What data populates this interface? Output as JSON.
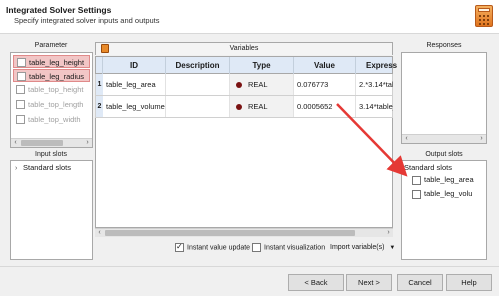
{
  "dialog": {
    "title": "Integrated Solver Settings",
    "subtitle": "Specify integrated solver inputs and outputs"
  },
  "parameter_panel": {
    "title": "Parameter",
    "items": [
      {
        "label": "table_leg_height",
        "selected": true,
        "dimmed": false
      },
      {
        "label": "table_leg_radius",
        "selected": true,
        "dimmed": false
      },
      {
        "label": "table_top_height",
        "selected": false,
        "dimmed": true
      },
      {
        "label": "table_top_length",
        "selected": false,
        "dimmed": true
      },
      {
        "label": "table_top_width",
        "selected": false,
        "dimmed": true
      }
    ]
  },
  "input_slots": {
    "title": "Input slots",
    "tree_root": "Standard slots"
  },
  "variables": {
    "title": "Variables",
    "columns": [
      "ID",
      "Description",
      "Type",
      "Value",
      "Express"
    ],
    "rows": [
      {
        "num": "1",
        "id": "table_leg_area",
        "description": "",
        "type": "REAL",
        "value": "0.076773",
        "expression": "2.*3.14*tabl"
      },
      {
        "num": "2",
        "id": "table_leg_volume",
        "description": "",
        "type": "REAL",
        "value": "0.0005652",
        "expression": "3.14*table_l"
      }
    ],
    "type_dot_color": "#7a1212"
  },
  "options": {
    "instant_value_update": {
      "label": "Instant value update",
      "checked": true
    },
    "instant_visualization": {
      "label": "Instant visualization",
      "checked": false
    },
    "import_variables": "Import variable(s)"
  },
  "responses": {
    "title": "Responses"
  },
  "output_slots": {
    "title": "Output slots",
    "tree_root": "Standard slots",
    "items": [
      "table_leg_area",
      "table_leg_volu"
    ]
  },
  "buttons": {
    "back": "< Back",
    "next": "Next >",
    "cancel": "Cancel",
    "help": "Help"
  },
  "colors": {
    "selection_bg": "#f2c6c6",
    "header_bg": "#dfe9f6",
    "annotation_arrow": "#e53935"
  }
}
